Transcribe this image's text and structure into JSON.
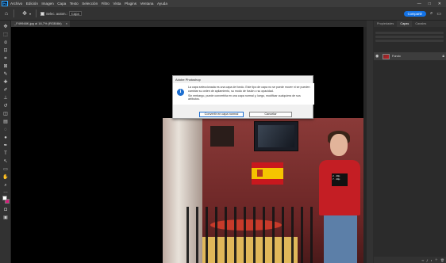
{
  "menubar": {
    "logo": "Ps",
    "items": [
      "Archivo",
      "Edición",
      "Imagen",
      "Capa",
      "Texto",
      "Selección",
      "Filtro",
      "Vista",
      "Plugins",
      "Ventana",
      "Ayuda"
    ],
    "min": "—",
    "max": "□",
    "close": "✕"
  },
  "options": {
    "auto_select_label": "Selec. autom.:",
    "auto_select_value": "Capa",
    "share_label": "Compartir"
  },
  "tab": {
    "title": "_F49948K.jpg al 16,7% (RGB/8#)",
    "close": "×"
  },
  "panel": {
    "tabs": [
      "Propiedades",
      "Capas",
      "Canales"
    ],
    "layer_name": "Fondo"
  },
  "dialog": {
    "title": "Adobe Photoshop",
    "icon": "i",
    "message1": "La capa seleccionada es una capa de fondo. Este tipo de capa no se puede mover ni se pueden cambiar su orden de apilamiento, su modo de fusión o su opacidad.",
    "message2": "Sin embargo, puede convertirla en una capa normal y, luego, modificar cualquiera de sus atributos.",
    "convert_label": "Convertir en capa normal",
    "cancel_label": "Cancelar"
  },
  "photo": {
    "jersey_line1": "2 · 40p",
    "jersey_line2": "7 · 40p"
  },
  "icons": [
    "photoshop-logo",
    "home-icon",
    "move-tool-icon",
    "eye-icon",
    "lock-icon",
    "info-icon",
    "search-icon",
    "gear-icon"
  ],
  "colors": {
    "accent": "#1473e6",
    "foreground": "#ffffff",
    "background": "#d81b7a"
  }
}
